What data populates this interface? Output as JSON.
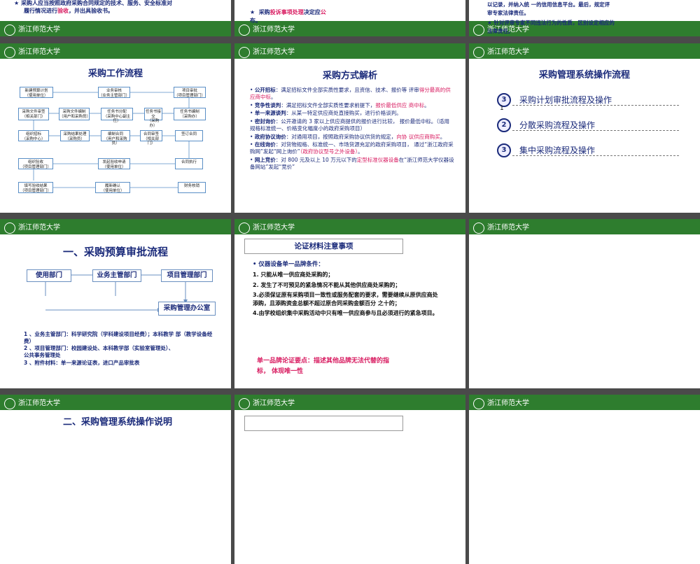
{
  "s1": {
    "text_a": "采购人应当按照政府采购合同规定的技术、服务、安全标准对",
    "text_b": "履行情况进行",
    "text_b_red": "验收",
    "text_b_end": "，并出具验收书。"
  },
  "s2": {
    "star": "★",
    "text_a": "采购",
    "text_red": "投诉事项处理",
    "text_b": "决定应",
    "text_c": "公",
    "text_d": "布。"
  },
  "s3": {
    "line1": "以记录，并纳入统 一的信用信息平台。最后，规定评",
    "line2": "审专家法律责任。",
    "line3": "★  针对评审专家不同违法行为的性质，区别设定相应的",
    "line4": "法律责任。"
  },
  "logo_text": "浙江师范大学",
  "s4": {
    "title": "采购工作流程",
    "boxes": [
      "新建预算计划\n（使用单位）",
      "业务审核\n（业务主管部门）",
      "项目审批\n（项目管理部门）",
      "采购文件审签\n（相关部门）",
      "采购文件编制\n（用户和采购员）",
      "任务书分配\n（采购中心副主任）",
      "任务书接交\n（采购办）",
      "任务书编制\n（采购办）",
      "组织招标\n（采购中心）",
      "采购结果处理\n（采购员）",
      "编制合同\n（用户和采购员）",
      "合同审签\n（相关部门）",
      "签订合同",
      "组织验收\n（项目管理部门）",
      "发起验收申请\n（使用单位）",
      "合同执行",
      "填写验收结果\n（项目管理部门）",
      "履新确认\n（使用单位）",
      "财务核销"
    ]
  },
  "s5": {
    "title": "采购方式解析",
    "items": [
      {
        "term": "公开招标",
        "text": "：满足招标文件全部实质性要求，且资信、技术、报价等 评审",
        "red": "得分最高的供应商中标",
        "tail": "。"
      },
      {
        "term": "竞争性谈判",
        "text": "：满足招标文件全部实质性要求前提下，",
        "red": "报价最低供应 商中标",
        "tail": "。"
      },
      {
        "term": "单一来源谈判",
        "text": "：从某一特定供应商处直接购买，进行价格谈判。",
        "red": "",
        "tail": ""
      },
      {
        "term": "密封询价",
        "text": "：公开邀请的 3 家以上供应商提供的报价进行比较， 报价最低中标。（适用规格标准统一、价格变化幅度小的政府采购项目）",
        "red": "",
        "tail": ""
      },
      {
        "term": "政府协议询价",
        "text": "：对通用项目，按照政府采购协议供货的规定，",
        "red": "向协 议供应商购买",
        "tail": "。"
      },
      {
        "term": "在线询价",
        "text": "：对货物规格、标准统一、市场货源充足的政府采购项目， 通过“浙江政府采购网”发起“网上询价”",
        "red": "（政府协议型号之外设备）",
        "tail": "。"
      },
      {
        "term": "网上竞价",
        "text": "：对 800 元及以上 10 万元以下的",
        "red": "定型标准仪器设备",
        "tail": "在“浙江师范大学仪器设备网站”发起“竞价”"
      }
    ]
  },
  "s6": {
    "title": "采购管理系统操作流程",
    "items": [
      {
        "num": "3",
        "label": "采购计划审批流程及操作",
        "sub": "1"
      },
      {
        "num": "2",
        "label": "分散采购流程及操作",
        "sub": ""
      },
      {
        "num": "3",
        "label": "集中采购流程及操作",
        "sub": ""
      }
    ]
  },
  "s7": {
    "title": "一、采购预算审批流程",
    "boxes": [
      "使用部门",
      "业务主管部门",
      "项目管理部门",
      "采购管理办公室"
    ],
    "notes": [
      "1 、业务主管部门：科学研究院（学科建设项目经费）；本科教学 部（教学设备经费）",
      "2 、项目管理部门：校园建设处、本科教学部（实验室管理处）、",
      "公共事务管理处",
      "3 、附件材料：单一来源论证表，进口产品审批表"
    ]
  },
  "s8": {
    "title": "论证材料注意事项",
    "heading": "• 仪器设备单一品牌条件：",
    "lines": [
      "1. 只能从唯一供应商处采购的；",
      "2. 发生了不可预见的紧急情况不能从其他供应商处采购的；",
      "3.必须保证原有采购项目一致性或服务配套的要求，需要继续从原供应商处添购，且添购资金总额不超过原合同采购金额百分 之十的；",
      "4.由学校组织集中采购活动中只有唯一供应商参与且必须进行的紧急项目。"
    ],
    "key_a": "单一品牌论证要点：描述其他品牌无法代替的指",
    "key_b": "标， 体现唯一性"
  },
  "s10": {
    "title": "二、采购管理系统操作说明"
  }
}
